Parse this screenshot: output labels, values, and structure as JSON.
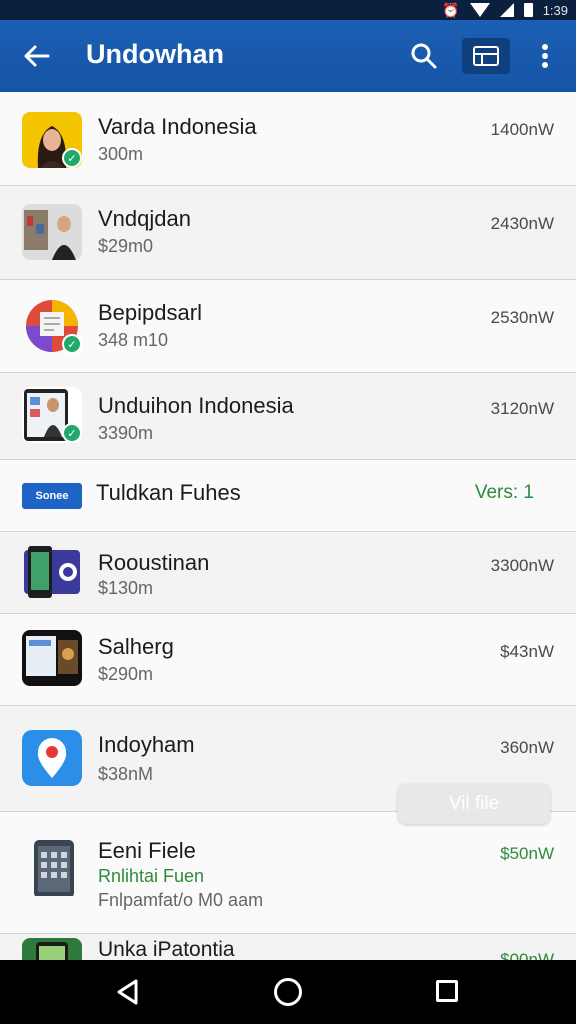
{
  "status_bar": {
    "time": "1:39"
  },
  "app_bar": {
    "title": "Undowhan"
  },
  "list": [
    {
      "title": "Varda Indonesia",
      "subtitle": "300m",
      "size": "1400nW",
      "verified": true
    },
    {
      "title": "Vndqjdan",
      "subtitle": "$29m0",
      "size": "2430nW",
      "verified": false
    },
    {
      "title": "Bepipdsarl",
      "subtitle": "348 m10",
      "size": "2530nW",
      "verified": true
    },
    {
      "title": "Unduihon Indonesia",
      "subtitle": "3390m",
      "size": "3120nW",
      "verified": true
    },
    {
      "title": "Tuldkan Fuhes",
      "subtitle": "",
      "size": "Vers: 1",
      "logo_text": "Sonee"
    },
    {
      "title": "Rooustinan",
      "subtitle": "$130m",
      "size": "3300nW"
    },
    {
      "title": "Salherg",
      "subtitle": "$290m",
      "size": "$43nW"
    },
    {
      "title": "Indoyham",
      "subtitle": "$38nM",
      "size": "360nW"
    },
    {
      "title": "Eeni Fiele",
      "subtitle": "Rnlihtai Fuen",
      "subtitle2": "Fnlpamfat/o M0 aam",
      "size": "$50nW"
    },
    {
      "title": "Unka iPatontia",
      "subtitle": "",
      "size": "$00nW"
    }
  ],
  "chip": {
    "label": "Vil file"
  },
  "colors": {
    "app_bar": "#1b5fb4",
    "accent_green": "#2e8b3a",
    "badge_green": "#1fa96b"
  }
}
